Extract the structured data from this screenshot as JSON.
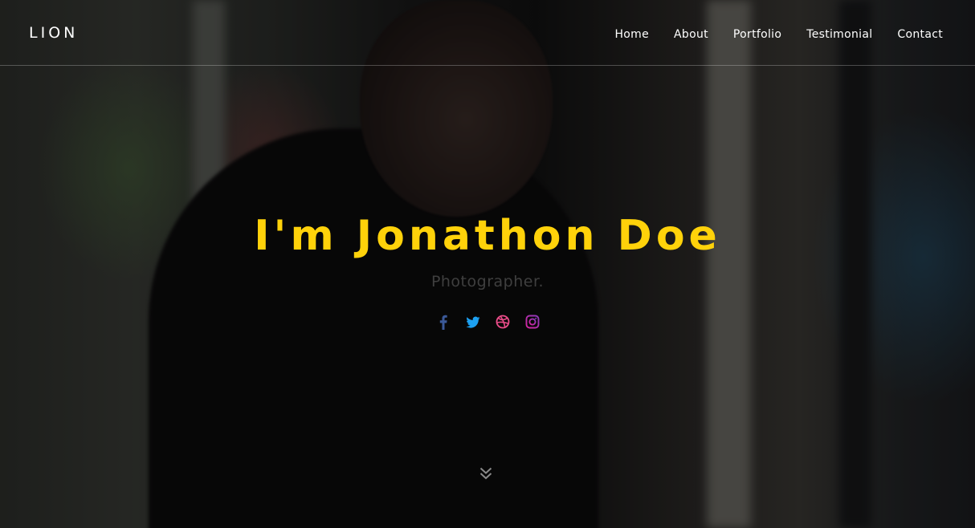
{
  "brand": {
    "name": "LION"
  },
  "nav": {
    "items": [
      {
        "label": "Home"
      },
      {
        "label": "About"
      },
      {
        "label": "Portfolio"
      },
      {
        "label": "Testimonial"
      },
      {
        "label": "Contact"
      }
    ]
  },
  "hero": {
    "title": "I'm Jonathon Doe",
    "subtitle": "Photographer."
  },
  "social": {
    "icons": [
      {
        "name": "facebook-icon",
        "color": "#3b5998"
      },
      {
        "name": "twitter-icon",
        "color": "#1da1f2"
      },
      {
        "name": "dribbble-icon",
        "color": "#ea4c89"
      },
      {
        "name": "instagram-icon",
        "color": "#8a3ab9"
      }
    ]
  },
  "scroll": {
    "icon": "double-chevron-down-icon"
  },
  "colors": {
    "accent": "#ffd20a",
    "nav_text": "#ffffff",
    "subtitle": "#3f3f3f"
  }
}
